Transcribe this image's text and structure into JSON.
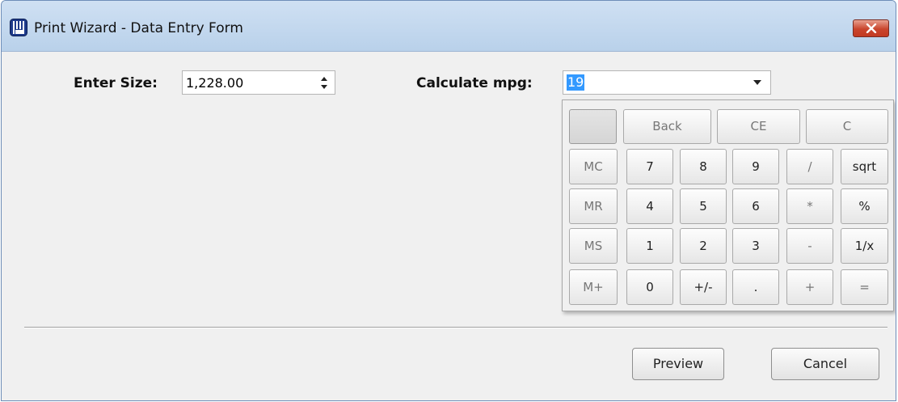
{
  "window": {
    "title": "Print Wizard - Data Entry Form",
    "icon": "print-wizard-app-icon",
    "close_icon": "close-icon"
  },
  "form": {
    "size_label": "Enter Size:",
    "size_value": "1,228.00",
    "mpg_label": "Calculate mpg:",
    "mpg_value": "19"
  },
  "calculator": {
    "top_row": [
      "",
      "Back",
      "CE",
      "C"
    ],
    "rows": [
      [
        "MC",
        "7",
        "8",
        "9",
        "/",
        "sqrt"
      ],
      [
        "MR",
        "4",
        "5",
        "6",
        "*",
        "%"
      ],
      [
        "MS",
        "1",
        "2",
        "3",
        "-",
        "1/x"
      ],
      [
        "M+",
        "0",
        "+/-",
        ".",
        "+",
        "="
      ]
    ]
  },
  "buttons": {
    "preview": "Preview",
    "cancel": "Cancel"
  },
  "colors": {
    "title_bar": "#c4d9f0",
    "close_button": "#c9452d",
    "selection": "#3399ff"
  }
}
